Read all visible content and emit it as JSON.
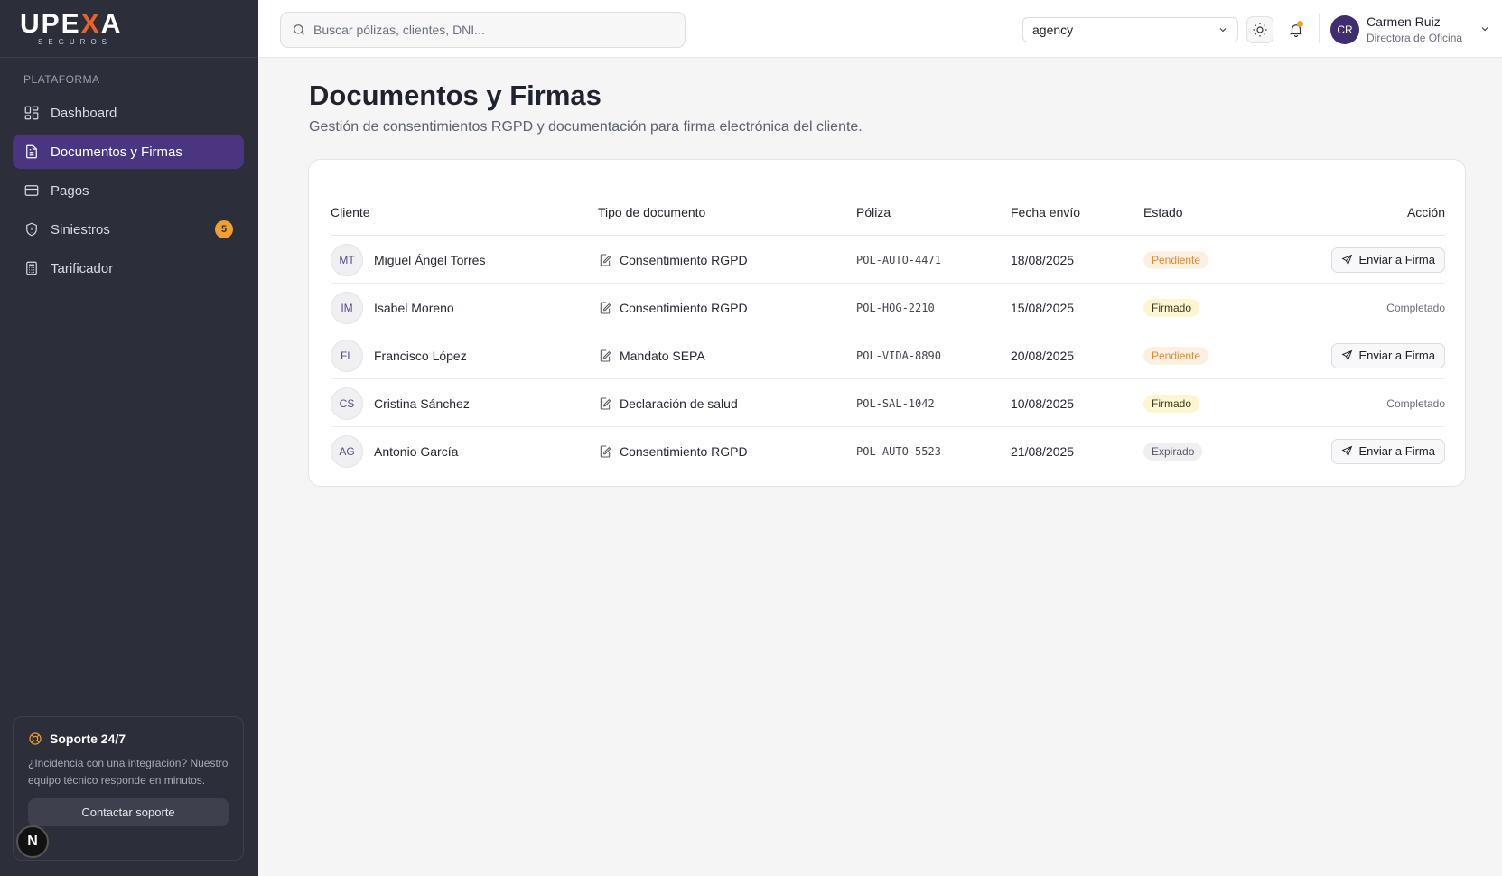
{
  "brand": {
    "logo_pre": "UPE",
    "logo_x": "X",
    "logo_post": "A",
    "logo_sub": "SEGUROS"
  },
  "sidebar": {
    "section": "PLATAFORMA",
    "items": [
      {
        "label": "Dashboard",
        "icon": "grid-icon"
      },
      {
        "label": "Documentos y Firmas",
        "icon": "document-icon"
      },
      {
        "label": "Pagos",
        "icon": "card-icon"
      },
      {
        "label": "Siniestros",
        "icon": "shield-icon",
        "badge": "5"
      },
      {
        "label": "Tarificador",
        "icon": "calculator-icon"
      }
    ],
    "support": {
      "title": "Soporte 24/7",
      "text": "¿Incidencia con una integración? Nuestro equipo técnico responde en minutos.",
      "button": "Contactar soporte"
    },
    "n_badge": "N"
  },
  "topbar": {
    "search_placeholder": "Buscar pólizas, clientes, DNI...",
    "selector_value": "agency",
    "user": {
      "initials": "CR",
      "name": "Carmen Ruiz",
      "role": "Directora de Oficina"
    }
  },
  "page": {
    "title": "Documentos y Firmas",
    "subtitle": "Gestión de consentimientos RGPD y documentación para firma electrónica del cliente."
  },
  "table": {
    "headers": {
      "cliente": "Cliente",
      "tipo": "Tipo de documento",
      "poliza": "Póliza",
      "fecha": "Fecha envío",
      "estado": "Estado",
      "accion": "Acción"
    },
    "rows": [
      {
        "initials": "MT",
        "client": "Miguel Ángel Torres",
        "doc": "Consentimiento RGPD",
        "policy": "POL-AUTO-4471",
        "date": "18/08/2025",
        "status": "Pendiente",
        "status_type": "pending",
        "action": "Enviar a Firma"
      },
      {
        "initials": "IM",
        "client": "Isabel Moreno",
        "doc": "Consentimiento RGPD",
        "policy": "POL-HOG-2210",
        "date": "15/08/2025",
        "status": "Firmado",
        "status_type": "signed",
        "action": "Completado"
      },
      {
        "initials": "FL",
        "client": "Francisco López",
        "doc": "Mandato SEPA",
        "policy": "POL-VIDA-8890",
        "date": "20/08/2025",
        "status": "Pendiente",
        "status_type": "pending",
        "action": "Enviar a Firma"
      },
      {
        "initials": "CS",
        "client": "Cristina Sánchez",
        "doc": "Declaración de salud",
        "policy": "POL-SAL-1042",
        "date": "10/08/2025",
        "status": "Firmado",
        "status_type": "signed",
        "action": "Completado"
      },
      {
        "initials": "AG",
        "client": "Antonio García",
        "doc": "Consentimiento RGPD",
        "policy": "POL-AUTO-5523",
        "date": "21/08/2025",
        "status": "Expirado",
        "status_type": "expired",
        "action": "Enviar a Firma"
      }
    ]
  },
  "colors": {
    "accent": "#4a3580",
    "sidebar_bg": "#2c2f3a",
    "warning": "#f0a030"
  }
}
